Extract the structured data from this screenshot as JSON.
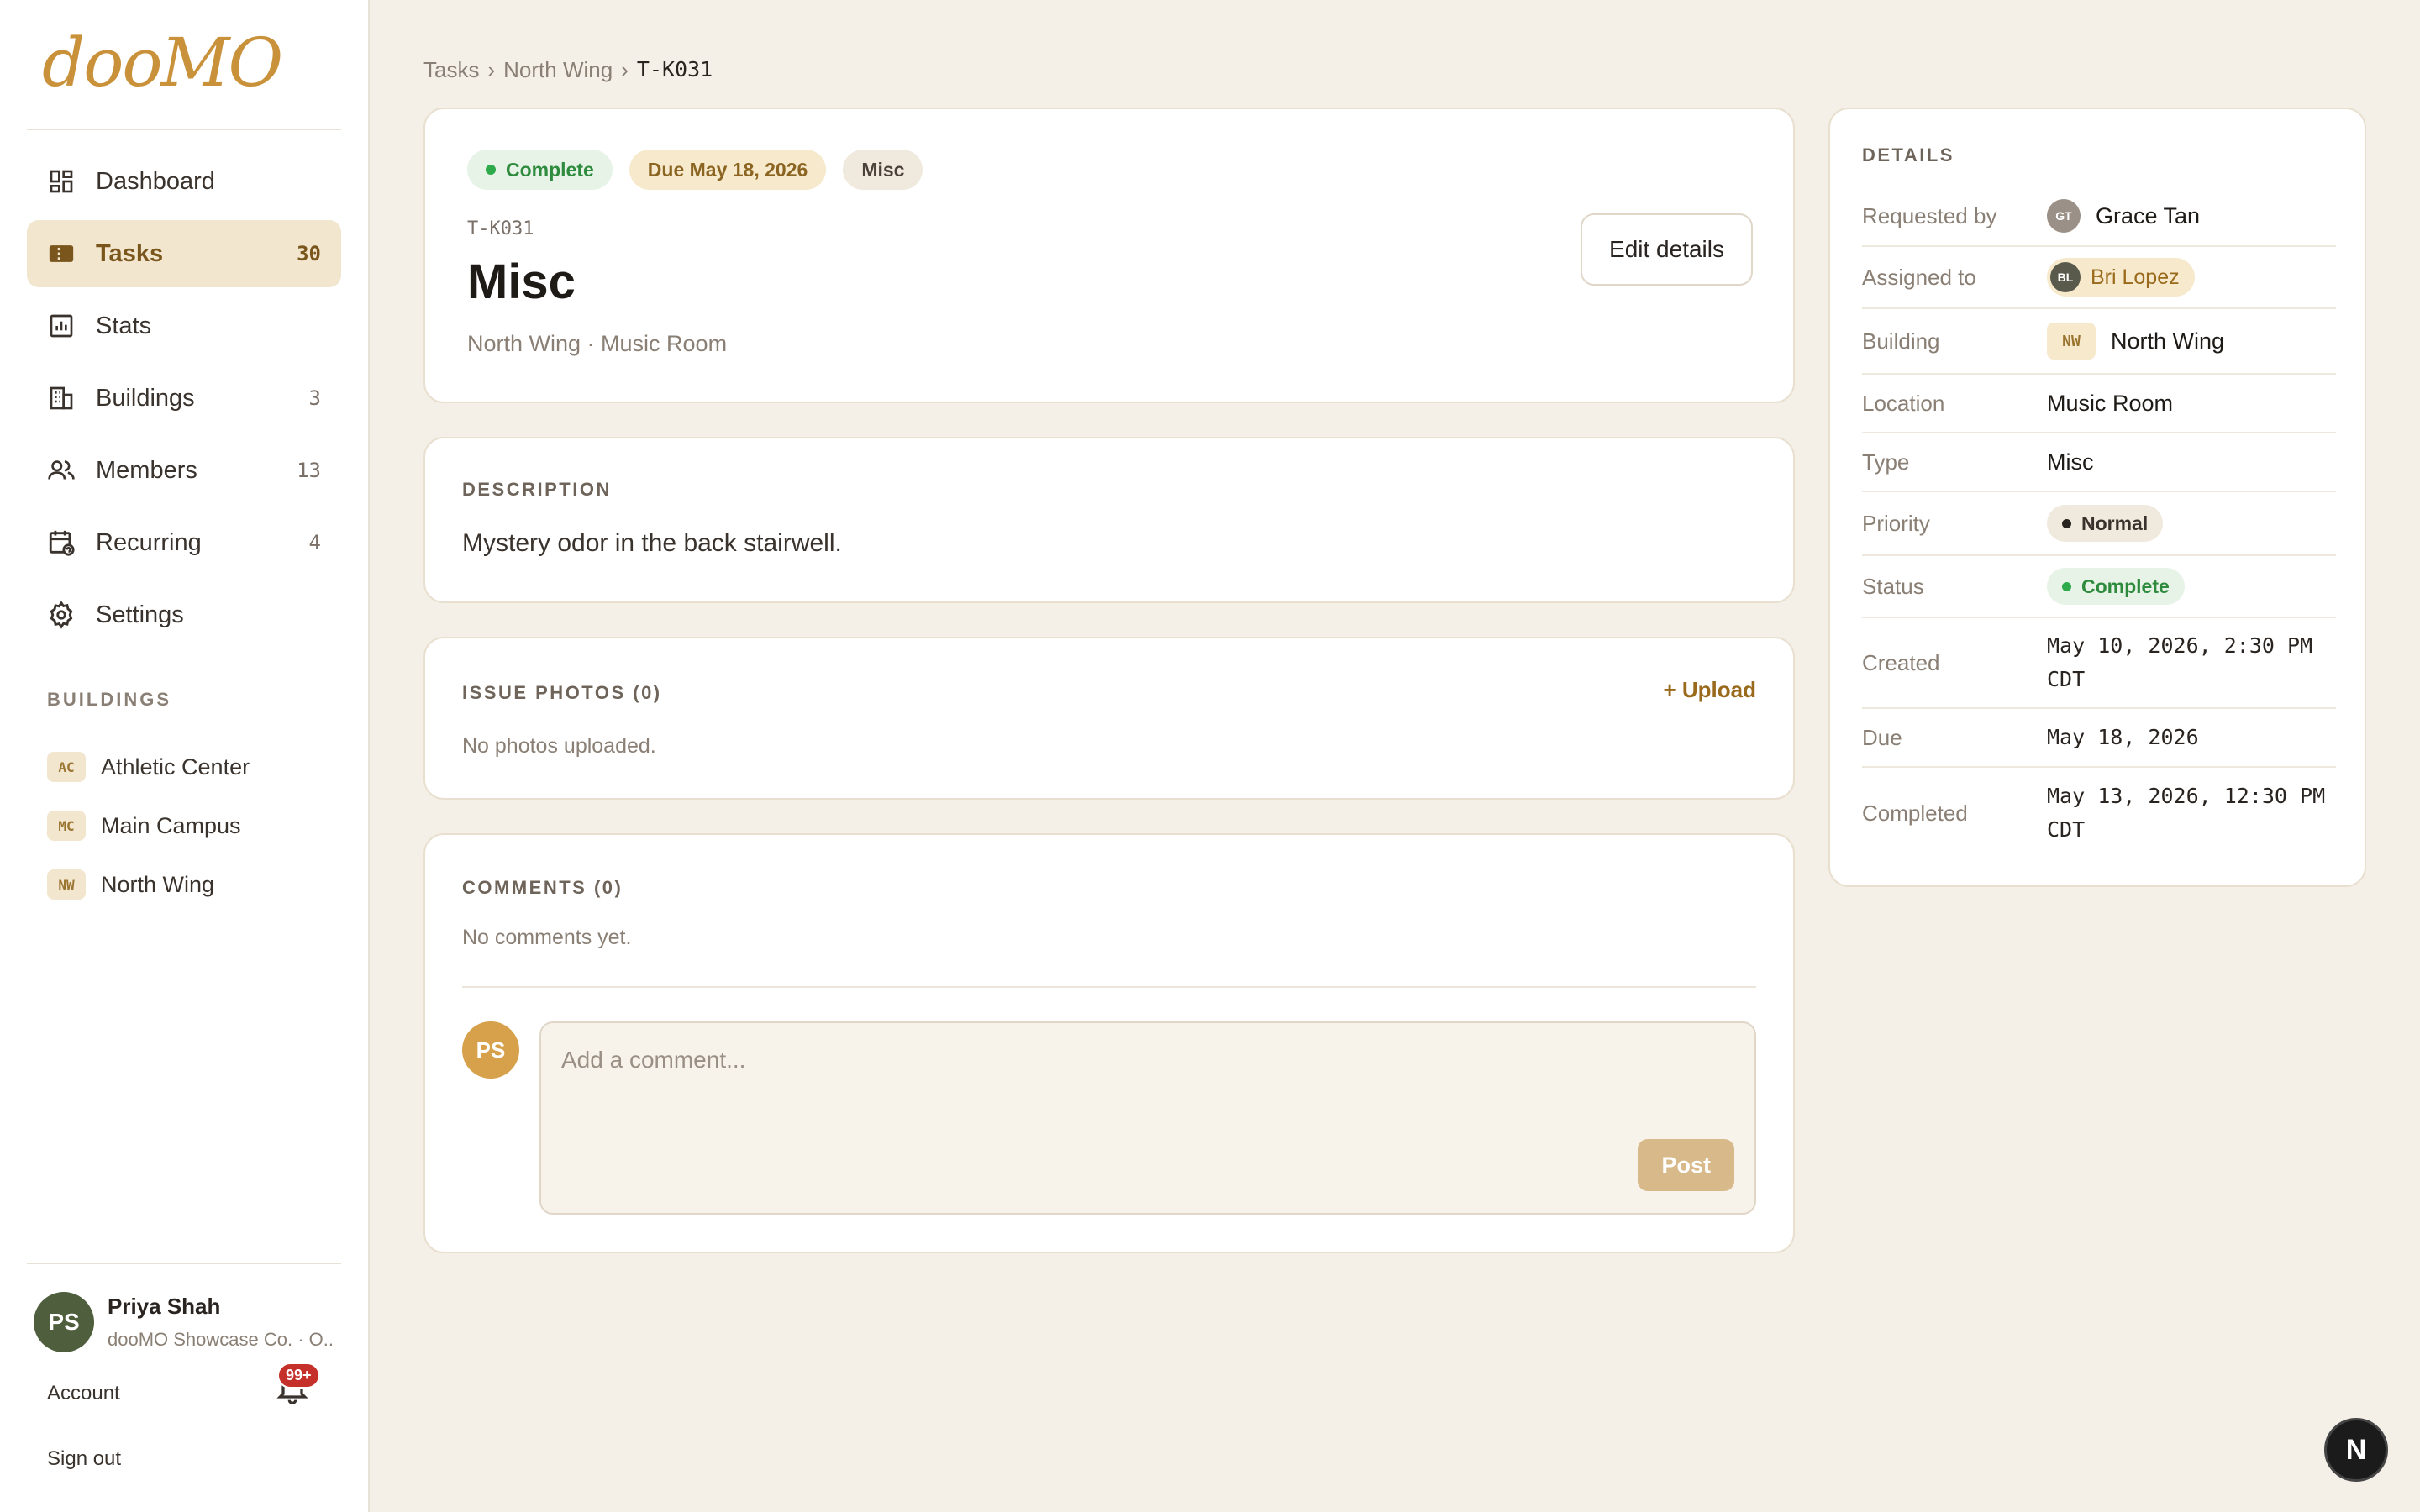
{
  "app": {
    "logo": "dooMO"
  },
  "sidebar": {
    "nav": [
      {
        "label": "Dashboard",
        "count": "",
        "icon": "dashboard-icon"
      },
      {
        "label": "Tasks",
        "count": "30",
        "icon": "tasks-icon"
      },
      {
        "label": "Stats",
        "count": "",
        "icon": "stats-icon"
      },
      {
        "label": "Buildings",
        "count": "3",
        "icon": "buildings-icon"
      },
      {
        "label": "Members",
        "count": "13",
        "icon": "members-icon"
      },
      {
        "label": "Recurring",
        "count": "4",
        "icon": "recurring-icon"
      },
      {
        "label": "Settings",
        "count": "",
        "icon": "gear-icon"
      }
    ],
    "buildings_heading": "BUILDINGS",
    "buildings": [
      {
        "code": "AC",
        "name": "Athletic Center"
      },
      {
        "code": "MC",
        "name": "Main Campus"
      },
      {
        "code": "NW",
        "name": "North Wing"
      }
    ],
    "user": {
      "initials": "PS",
      "name": "Priya Shah",
      "org": "dooMO Showcase Co. · O..."
    },
    "account_label": "Account",
    "notification_count": "99+",
    "signout_label": "Sign out"
  },
  "breadcrumb": {
    "root": "Tasks",
    "sep1": "›",
    "building": "North Wing",
    "sep2": "›",
    "current": "T-K031"
  },
  "task": {
    "status_pill": "Complete",
    "due_pill": "Due May 18, 2026",
    "type_pill": "Misc",
    "id": "T-K031",
    "title": "Misc",
    "subtitle": "North Wing · Music Room",
    "edit_label": "Edit details"
  },
  "description": {
    "heading": "DESCRIPTION",
    "text": "Mystery odor in the back stairwell."
  },
  "photos": {
    "heading": "ISSUE PHOTOS (0)",
    "upload_label": "+ Upload",
    "empty": "No photos uploaded."
  },
  "comments": {
    "heading": "COMMENTS (0)",
    "empty": "No comments yet.",
    "avatar": "PS",
    "placeholder": "Add a comment...",
    "post_label": "Post"
  },
  "details": {
    "heading": "DETAILS",
    "requested_by_label": "Requested by",
    "requested_by_initials": "GT",
    "requested_by": "Grace Tan",
    "assigned_to_label": "Assigned to",
    "assigned_to_initials": "BL",
    "assigned_to": "Bri Lopez",
    "building_label": "Building",
    "building_code": "NW",
    "building": "North Wing",
    "location_label": "Location",
    "location": "Music Room",
    "type_label": "Type",
    "type": "Misc",
    "priority_label": "Priority",
    "priority": "Normal",
    "status_label": "Status",
    "status": "Complete",
    "created_label": "Created",
    "created_line1": "May 10, 2026, 2:30 PM",
    "created_line2": "CDT",
    "due_label": "Due",
    "due": "May 18, 2026",
    "completed_label": "Completed",
    "completed_line1": "May 13, 2026, 12:30 PM",
    "completed_line2": "CDT"
  },
  "floating_badge": "N",
  "colors": {
    "accent": "#c9923a",
    "background": "#f4efe7",
    "success": "#2eaa4a"
  }
}
